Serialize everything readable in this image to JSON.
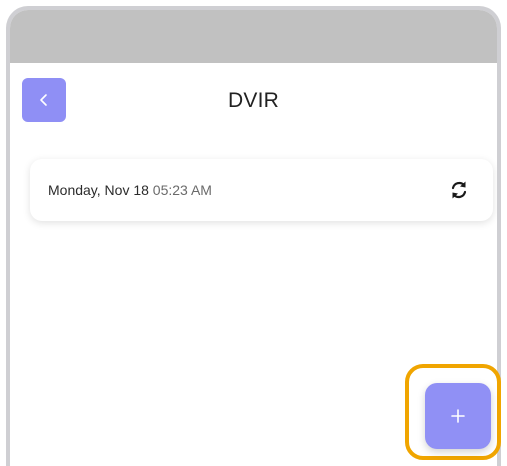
{
  "header": {
    "title": "DVIR",
    "back_icon": "chevron-left-icon"
  },
  "entries": [
    {
      "date": "Monday, Nov 18",
      "time": "05:23 AM",
      "action_icon": "sync-icon"
    }
  ],
  "fab": {
    "icon": "plus-icon"
  },
  "colors": {
    "accent": "#9090f5",
    "status_bar": "#c1c1c1",
    "highlight": "#f0a500"
  }
}
